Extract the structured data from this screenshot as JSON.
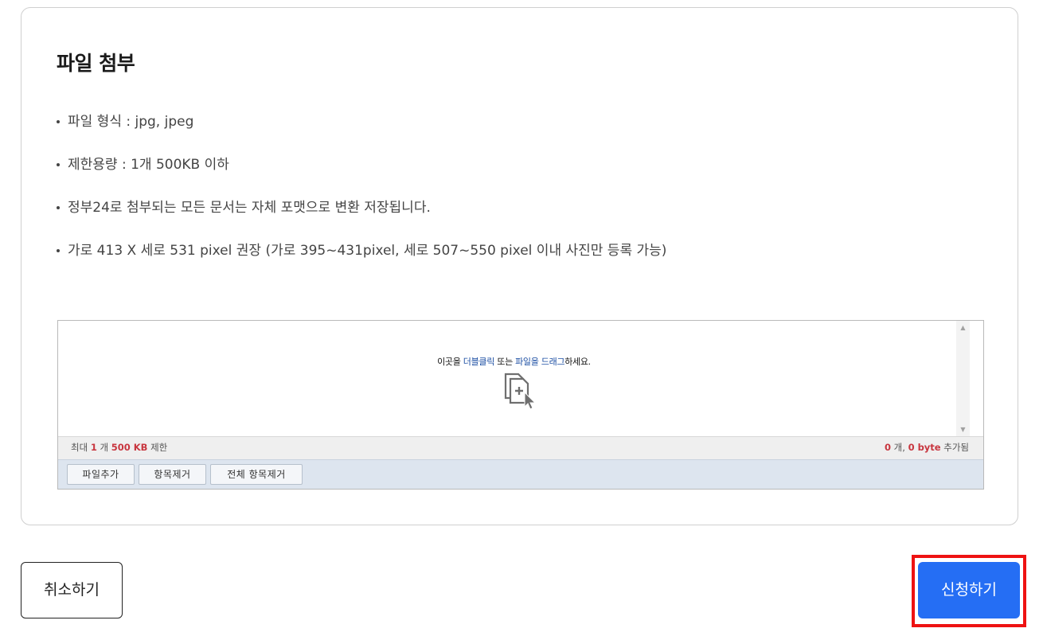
{
  "section": {
    "title": "파일 첨부",
    "guide_items": [
      "파일 형식 : jpg, jpeg",
      "제한용량 : 1개 500KB 이하",
      "정부24로 첨부되는 모든 문서는 자체 포맷으로 변환 저장됩니다.",
      "가로 413 X 세로 531 pixel 권장 (가로 395~431pixel, 세로 507~550 pixel 이내 사진만 등록 가능)"
    ]
  },
  "uploader": {
    "drop_text": {
      "part1": "이곳을 ",
      "link1": "더블클릭",
      "part2": " 또는 ",
      "link2": "파일을 드래그",
      "part3": "하세요."
    },
    "drop_icon": "add-file-cursor-icon",
    "limit": {
      "prefix": "최대 ",
      "count": "1",
      "count_unit": " 개 ",
      "size": "500 KB",
      "suffix": " 제한"
    },
    "added": {
      "count": "0",
      "count_unit": " 개, ",
      "size": "0 byte",
      "suffix": " 추가됨"
    },
    "buttons": {
      "add": "파일추가",
      "remove": "항목제거",
      "remove_all": "전체 항목제거"
    }
  },
  "actions": {
    "cancel": "취소하기",
    "submit": "신청하기"
  },
  "colors": {
    "primary": "#256ef4",
    "highlight": "#ee1212",
    "accent_red": "#c8363f",
    "link_blue": "#1d4fa3"
  }
}
